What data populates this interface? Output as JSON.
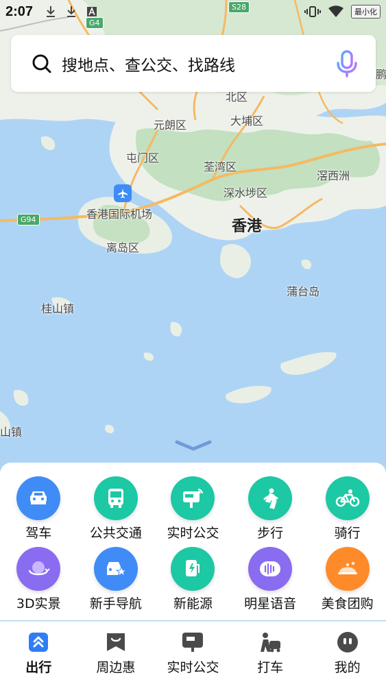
{
  "status_bar": {
    "time": "2:07",
    "minimize_label": "最小化"
  },
  "search": {
    "placeholder": "搜地点、查公交、找路线"
  },
  "map": {
    "labels": {
      "yuanlang": "元朗区",
      "dapu": "大埔区",
      "tunmen": "屯门区",
      "quanwan": "荃湾区",
      "shenshuibu": "深水埗区",
      "xixizhou": "滘西洲",
      "airport": "香港国际机场",
      "hongkong": "香港",
      "lidao": "离岛区",
      "putaidao": "蒲台岛",
      "guishan": "桂山镇",
      "wanshan": "山镇",
      "beiqu": "北区",
      "edge_char": "鹏"
    },
    "road_shields": {
      "g94": "G94",
      "s28": "S28",
      "g4": "G4"
    }
  },
  "tools": [
    {
      "label": "驾车",
      "icon": "car-icon",
      "color": "#3f8cf7"
    },
    {
      "label": "公共交通",
      "icon": "bus-icon",
      "color": "#1dc8a4"
    },
    {
      "label": "实时公交",
      "icon": "realtime-bus-icon",
      "color": "#1dc8a4"
    },
    {
      "label": "步行",
      "icon": "walk-icon",
      "color": "#1dc8a4"
    },
    {
      "label": "骑行",
      "icon": "bike-icon",
      "color": "#1dc8a4"
    },
    {
      "label": "3D实景",
      "icon": "globe-3d-icon",
      "color": "#8a6cf0"
    },
    {
      "label": "新手导航",
      "icon": "novice-car-icon",
      "color": "#3f8cf7"
    },
    {
      "label": "新能源",
      "icon": "charging-icon",
      "color": "#1dc8a4"
    },
    {
      "label": "明星语音",
      "icon": "voice-icon",
      "color": "#8a6cf0"
    },
    {
      "label": "美食团购",
      "icon": "food-icon",
      "color": "#ff8a2a"
    }
  ],
  "tabs": [
    {
      "label": "出行",
      "icon": "travel-icon",
      "active": true
    },
    {
      "label": "周边惠",
      "icon": "nearby-deals-icon"
    },
    {
      "label": "实时公交",
      "icon": "bus-stop-icon"
    },
    {
      "label": "打车",
      "icon": "taxi-icon"
    },
    {
      "label": "我的",
      "icon": "profile-icon"
    }
  ]
}
